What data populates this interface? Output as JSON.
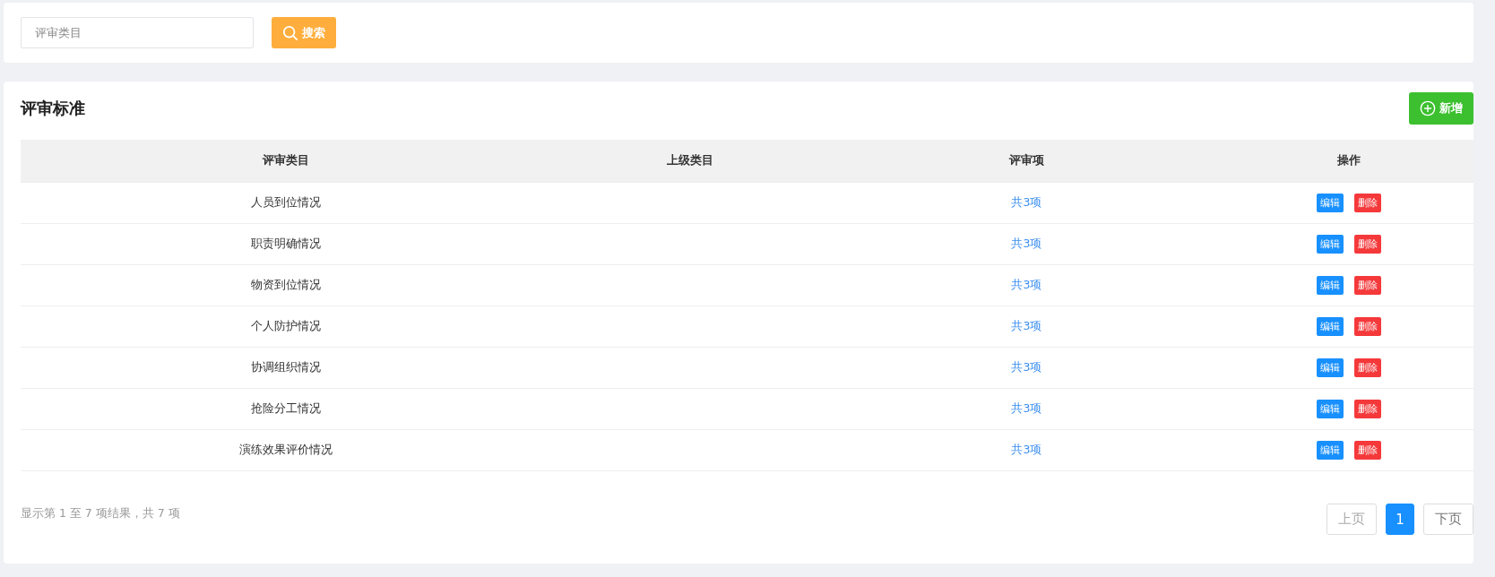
{
  "search": {
    "placeholder": "评审类目",
    "button": "搜索"
  },
  "panel": {
    "title": "评审标准",
    "add_button": "新增"
  },
  "table": {
    "columns": [
      "评审类目",
      "上级类目",
      "评审项",
      "操作"
    ],
    "rows": [
      {
        "category": "人员到位情况",
        "parent": "",
        "items": "共3项",
        "actions": [
          "编辑",
          "删除"
        ]
      },
      {
        "category": "职责明确情况",
        "parent": "",
        "items": "共3项",
        "actions": [
          "编辑",
          "删除"
        ]
      },
      {
        "category": "物资到位情况",
        "parent": "",
        "items": "共3项",
        "actions": [
          "编辑",
          "删除"
        ]
      },
      {
        "category": "个人防护情况",
        "parent": "",
        "items": "共3项",
        "actions": [
          "编辑",
          "删除"
        ]
      },
      {
        "category": "协调组织情况",
        "parent": "",
        "items": "共3项",
        "actions": [
          "编辑",
          "删除"
        ]
      },
      {
        "category": "抢险分工情况",
        "parent": "",
        "items": "共3项",
        "actions": [
          "编辑",
          "删除"
        ]
      },
      {
        "category": "演练效果评价情况",
        "parent": "",
        "items": "共3项",
        "actions": [
          "编辑",
          "删除"
        ]
      }
    ]
  },
  "summary": "显示第 1 至 7 项结果，共 7 项",
  "pagination": {
    "prev": {
      "label": "上页",
      "disabled": true
    },
    "pages": [
      {
        "label": "1",
        "selected": true
      }
    ],
    "next": {
      "label": "下页",
      "disabled": false
    }
  }
}
